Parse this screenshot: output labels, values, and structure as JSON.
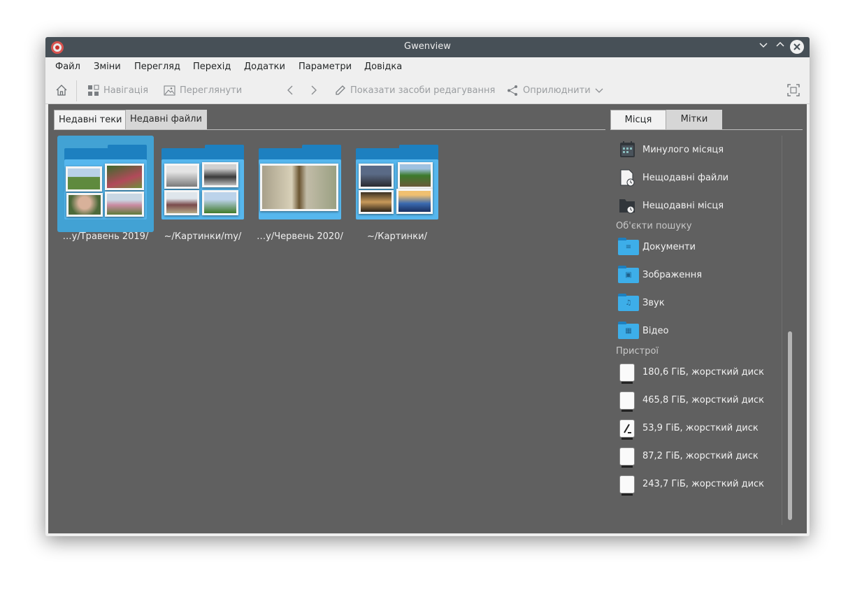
{
  "window": {
    "title": "Gwenview"
  },
  "menu": [
    "Файл",
    "Зміни",
    "Перегляд",
    "Перехід",
    "Додатки",
    "Параметри",
    "Довідка"
  ],
  "toolbar": {
    "navigation": "Навігація",
    "view": "Переглянути",
    "edit_tools": "Показати засоби редагування",
    "share": "Оприлюднити"
  },
  "left_tabs": [
    "Недавні теки",
    "Недавні файли"
  ],
  "folders": [
    {
      "label": "…y/Травень 2019/",
      "selected": true
    },
    {
      "label": "~/Картинки/my/",
      "selected": false
    },
    {
      "label": "…y/Червень 2020/",
      "selected": false
    },
    {
      "label": "~/Картинки/",
      "selected": false
    }
  ],
  "right_tabs": [
    "Місця",
    "Мітки"
  ],
  "places": {
    "recent": [
      "Минулого місяця",
      "Нещодавні файли",
      "Нещодавні місця"
    ],
    "search_header": "Об'єкти пошуку",
    "search": [
      "Документи",
      "Зображення",
      "Звук",
      "Відео"
    ],
    "devices_header": "Пристрої",
    "devices": [
      "180,6 ГіБ, жорсткий диск",
      "465,8 ГіБ, жорсткий диск",
      "53,9 ГіБ, жорсткий диск",
      "87,2 ГіБ, жорсткий диск",
      "243,7 ГіБ, жорсткий диск"
    ]
  },
  "colors": {
    "accent": "#3daee9",
    "titlebar": "#475057",
    "content_bg": "#606060"
  }
}
